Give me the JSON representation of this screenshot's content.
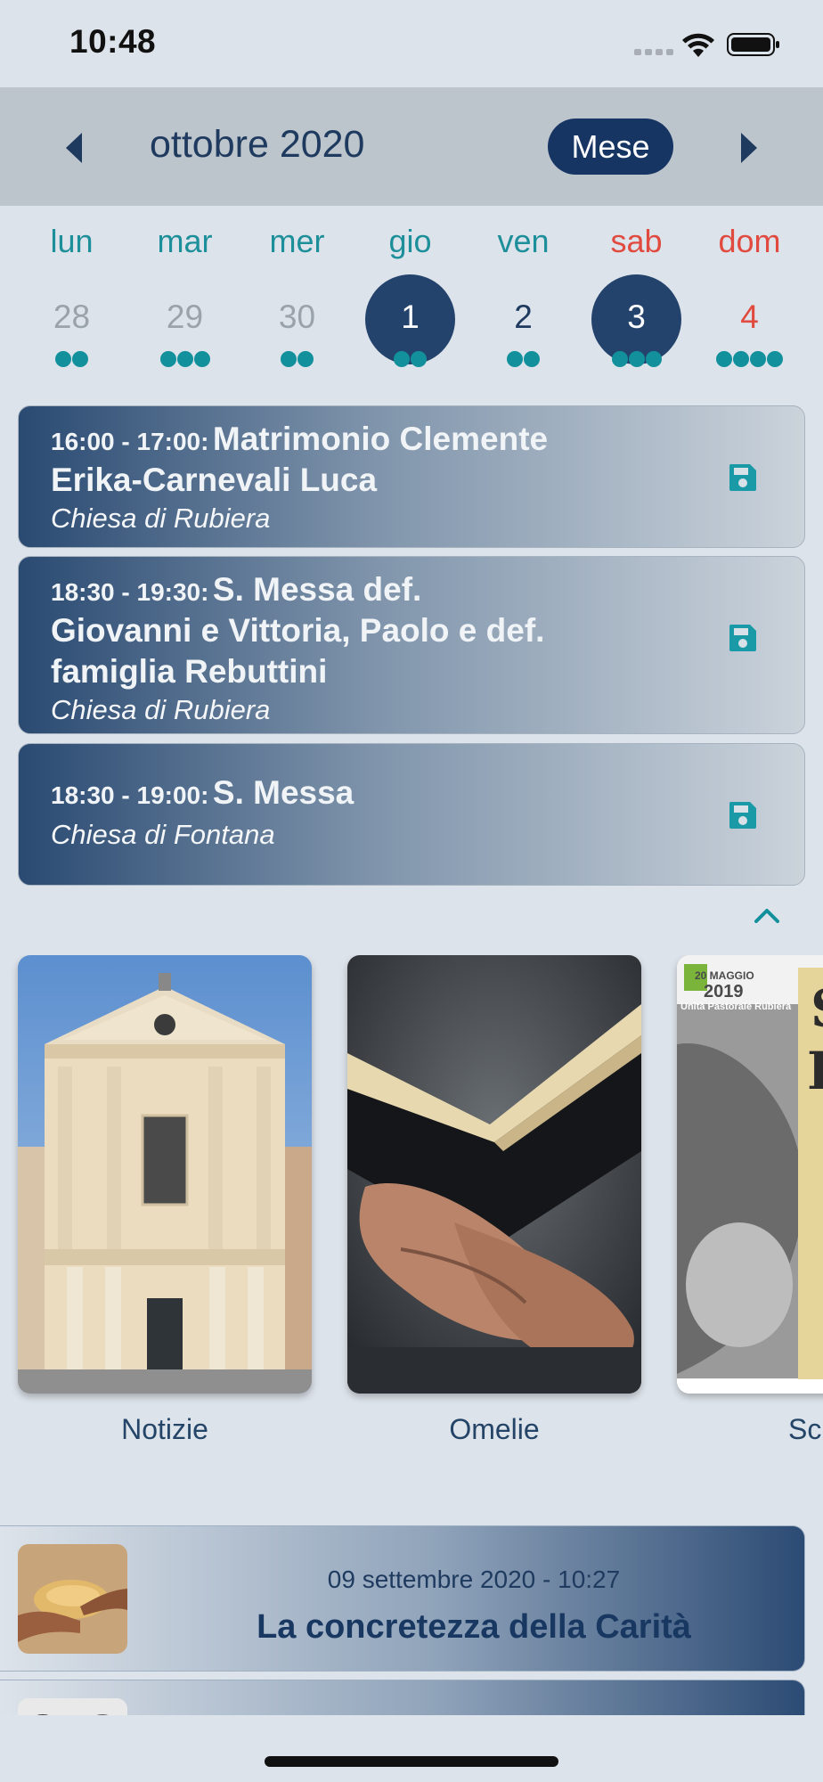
{
  "status_bar": {
    "time": "10:48"
  },
  "calendar": {
    "month_title": "ottobre 2020",
    "view_button": "Mese",
    "weekdays": [
      "lun",
      "mar",
      "mer",
      "gio",
      "ven",
      "sab",
      "dom"
    ],
    "days": [
      {
        "label": "28",
        "dots": 2,
        "state": "muted"
      },
      {
        "label": "29",
        "dots": 3,
        "state": "muted"
      },
      {
        "label": "30",
        "dots": 2,
        "state": "muted"
      },
      {
        "label": "1",
        "dots": 2,
        "state": "selected"
      },
      {
        "label": "2",
        "dots": 2,
        "state": "normal"
      },
      {
        "label": "3",
        "dots": 3,
        "state": "selected"
      },
      {
        "label": "4",
        "dots": 4,
        "state": "sunday"
      }
    ]
  },
  "events": [
    {
      "time": "16:00 - 17:00:",
      "title": "Matrimonio Clemente",
      "title_cont": [
        "Erika-Carnevali Luca"
      ],
      "place": "Chiesa di Rubiera"
    },
    {
      "time": "18:30 - 19:30:",
      "title": "S. Messa def.",
      "title_cont": [
        "Giovanni e Vittoria, Paolo e def.",
        "famiglia Rebuttini"
      ],
      "place": "Chiesa di Rubiera"
    },
    {
      "time": "18:30 - 19:00:",
      "title": "S. Messa",
      "title_cont": [],
      "place": "Chiesa di Fontana"
    }
  ],
  "cards": [
    {
      "label": "Notizie"
    },
    {
      "label": "Omelie"
    },
    {
      "label": "Sc. di",
      "poster_date": "20 MAGGIO",
      "poster_year": "2019",
      "poster_org": "Unità Pastorale Rubiera"
    }
  ],
  "news": [
    {
      "date": "09 settembre 2020 - 10:27",
      "title": "La concretezza della Carità"
    }
  ],
  "colors": {
    "primary": "#163563",
    "teal": "#12909c",
    "red": "#e04a3f",
    "background": "#dde3ea"
  }
}
